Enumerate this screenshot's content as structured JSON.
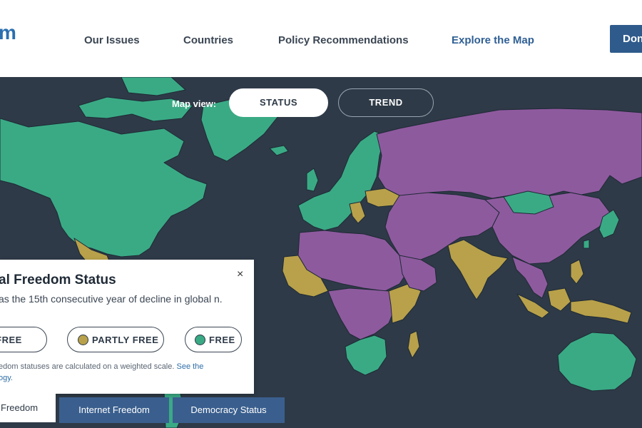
{
  "header": {
    "logo_fragment": "m",
    "nav": [
      {
        "label": "Our Issues",
        "active": false
      },
      {
        "label": "Countries",
        "active": false
      },
      {
        "label": "Policy Recommendations",
        "active": false
      },
      {
        "label": "Explore the Map",
        "active": true
      }
    ],
    "donate_label": "Don"
  },
  "map": {
    "view_label": "Map view:",
    "toggles": {
      "status": "STATUS",
      "trend": "TREND"
    },
    "colors": {
      "ocean": "#2e3a47",
      "free": "#3aaa85",
      "partly_free": "#b8a14a",
      "not_free": "#8e5a9e",
      "border": "#1f2a36"
    }
  },
  "panel": {
    "title": "al Freedom Status",
    "close_icon": "×",
    "description": "as the 15th consecutive year of decline in global n.",
    "legend": {
      "not_free": "OT FREE",
      "partly_free": "PARTLY FREE",
      "free": "FREE"
    },
    "note_text": "edom statuses are calculated on a weighted scale. ",
    "note_link": "See the ogy."
  },
  "tabs": {
    "global": "Freedom",
    "internet": "Internet Freedom",
    "democracy": "Democracy Status"
  }
}
